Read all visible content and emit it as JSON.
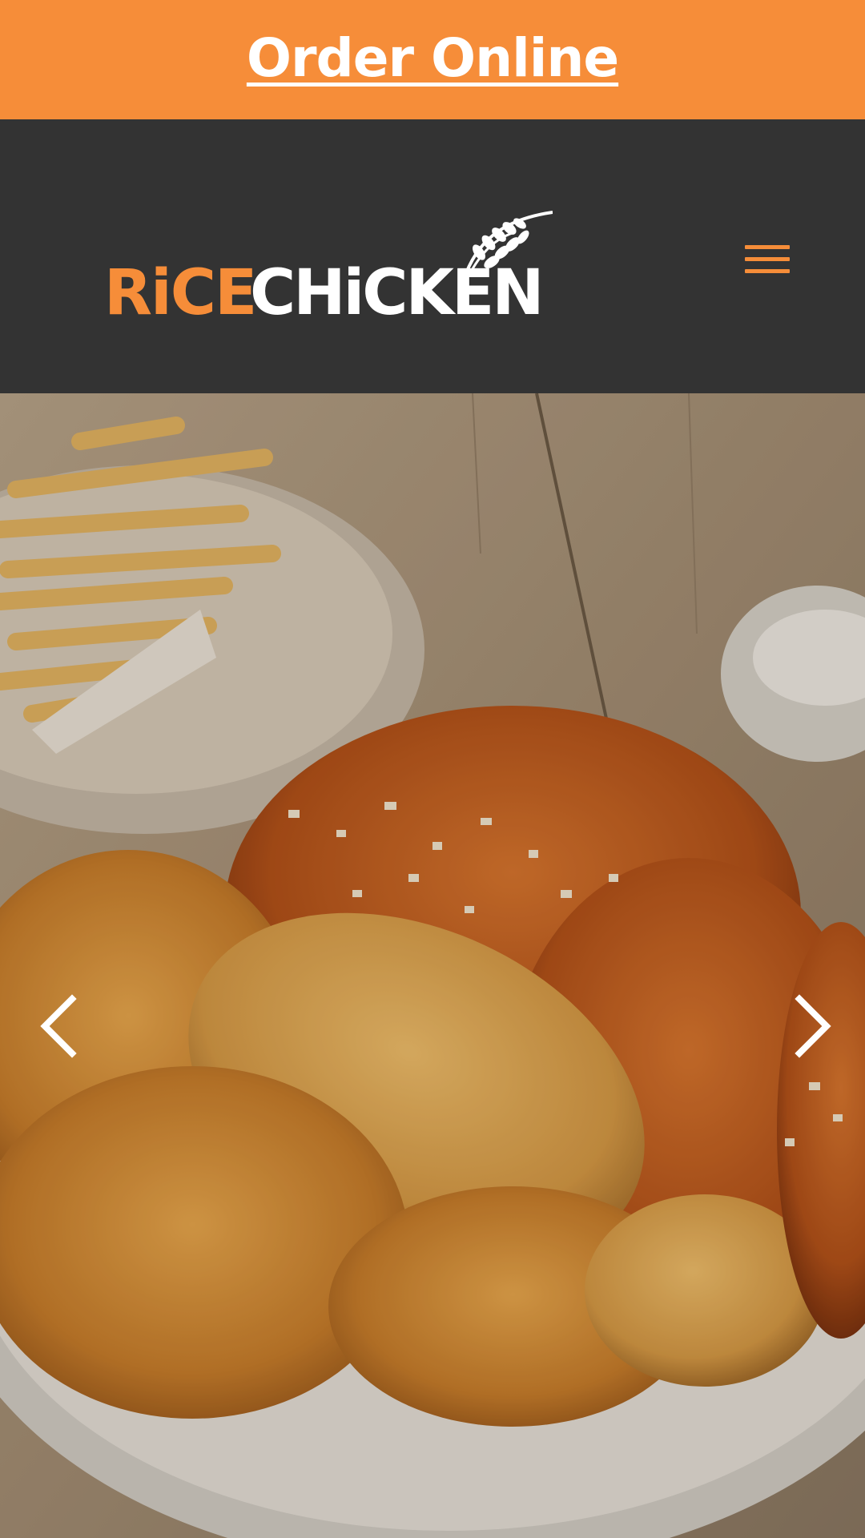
{
  "banner": {
    "order_label": "Order Online",
    "background_color": "#f68d39"
  },
  "header": {
    "logo": {
      "word_rice": "RiCE",
      "word_chicken": "CHiCKEN",
      "rice_color": "#f68d39",
      "chicken_color": "#ffffff"
    },
    "menu_icon": "hamburger-icon",
    "background_color": "#333333"
  },
  "hero": {
    "image_icon": "fried-chicken-photo",
    "prev_icon": "chevron-left-icon",
    "next_icon": "chevron-right-icon"
  }
}
